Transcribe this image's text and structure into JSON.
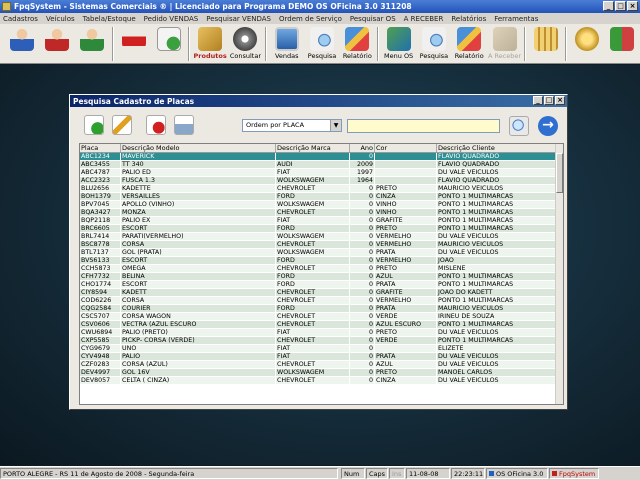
{
  "window_title": "FpqSystem - Sistemas Comerciais ® | Licenciado para Programa DEMO OS OFicina 3.0 311208",
  "menu": [
    "Cadastros",
    "Veículos",
    "Tabela/Estoque",
    "Pedido VENDAS",
    "Pesquisar VENDAS",
    "Ordem de Serviço",
    "Pesquisar OS",
    "A RECEBER",
    "Relatórios",
    "Ferramentas"
  ],
  "toolbar": [
    {
      "icon": "person-blue-icon",
      "label": ""
    },
    {
      "icon": "person-red-icon",
      "label": ""
    },
    {
      "icon": "person-green-icon",
      "label": ""
    },
    {
      "icon": "car-icon",
      "label": ""
    },
    {
      "icon": "calendar-clock-icon",
      "label": ""
    },
    {
      "icon": "boxes-icon",
      "label": "Produtos"
    },
    {
      "icon": "disc-icon",
      "label": "Consultar"
    },
    {
      "icon": "monitor-icon",
      "label": "Vendas"
    },
    {
      "icon": "magnifier-doc-icon",
      "label": "Pesquisa"
    },
    {
      "icon": "report-icon",
      "label": "Relatório"
    },
    {
      "icon": "menu-os-icon",
      "label": "Menu OS"
    },
    {
      "icon": "magnifier-doc-icon",
      "label": "Pesquisa"
    },
    {
      "icon": "report-icon",
      "label": "Relatório"
    },
    {
      "icon": "receivable-icon",
      "label": "A Receber"
    },
    {
      "icon": "calculator-icon",
      "label": ""
    },
    {
      "icon": "coins-icon",
      "label": ""
    },
    {
      "icon": "exit-icon",
      "label": ""
    }
  ],
  "dialog": {
    "title": "Pesquisa Cadastro de Placas",
    "order_select": "Ordem por PLACA",
    "search_value": "",
    "columns": [
      "Placa",
      "Descrição Modelo",
      "Descrição Marca",
      "Ano",
      "Cor",
      "Descrição Cliente"
    ],
    "rows": [
      [
        "ABC1234",
        "MAVERICK",
        "",
        "0",
        "",
        "FLAVIO QUADRADO"
      ],
      [
        "ABC3455",
        "TT 340",
        "AUDI",
        "2009",
        "",
        "FLAVIO QUADRADO"
      ],
      [
        "ABC4787",
        "PALIO ED",
        "FIAT",
        "1997",
        "",
        "DU VALE VEICULOS"
      ],
      [
        "ACC2323",
        "FUSCA 1.3",
        "WOLKSWAGEM",
        "1964",
        "",
        "FLAVIO QUADRADO"
      ],
      [
        "BLU2656",
        "KADETTE",
        "CHEVROLET",
        "0",
        "PRETO",
        "MAURICIO VEICULOS"
      ],
      [
        "BOH1379",
        "VERSAILLES",
        "FORD",
        "0",
        "CINZA",
        "PONTO 1 MULTIMARCAS"
      ],
      [
        "BPV7045",
        "APOLLO (VINHO)",
        "WOLKSWAGEM",
        "0",
        "VINHO",
        "PONTO 1 MULTIMARCAS"
      ],
      [
        "BQA3427",
        "MONZA",
        "CHEVROLET",
        "0",
        "VINHO",
        "PONTO 1 MULTIMARCAS"
      ],
      [
        "BQP2118",
        "PALIO EX",
        "FIAT",
        "0",
        "GRAFITE",
        "PONTO 1 MULTIMARCAS"
      ],
      [
        "BRC6605",
        "ESCORT",
        "FORD",
        "0",
        "PRETO",
        "PONTO 1 MULTIMARCAS"
      ],
      [
        "BRL7414",
        "PARATI(VERMELHO)",
        "WOLKSWAGEM",
        "0",
        "VERMELHO",
        "DU VALE VEICULOS"
      ],
      [
        "BSC8778",
        "CORSA",
        "CHEVROLET",
        "0",
        "VERMELHO",
        "MAURICIO VEICULOS"
      ],
      [
        "BTL7137",
        "GOL (PRATA)",
        "WOLKSWAGEM",
        "0",
        "PRATA",
        "DU VALE VEICULOS"
      ],
      [
        "BVS6133",
        "ESCORT",
        "FORD",
        "0",
        "VERMELHO",
        "JOÃO"
      ],
      [
        "CCH5873",
        "OMEGA",
        "CHEVROLET",
        "0",
        "PRETO",
        "MISLENE"
      ],
      [
        "CFH7732",
        "BELINA",
        "FORD",
        "0",
        "AZUL",
        "PONTO 1 MULTIMARCAS"
      ],
      [
        "CHO1774",
        "ESCORT",
        "FORD",
        "0",
        "PRATA",
        "PONTO 1 MULTIMARCAS"
      ],
      [
        "CIY8594",
        "KADETT",
        "CHEVROLET",
        "0",
        "GRAFITE",
        "JOÃO DO KADETT"
      ],
      [
        "COD6226",
        "CORSA",
        "CHEVROLET",
        "0",
        "VERMELHO",
        "PONTO 1 MULTIMARCAS"
      ],
      [
        "CQG2584",
        "COURIER",
        "FORD",
        "0",
        "PRATA",
        "MAURICIO VEICULOS"
      ],
      [
        "CSC5707",
        "CORSA WAGON",
        "CHEVROLET",
        "0",
        "VERDE",
        "IRINEU DE SOUZA"
      ],
      [
        "CSV0606",
        "VECTRA (AZUL ESCURO",
        "CHEVROLET",
        "0",
        "AZUL ESCURO",
        "PONTO 1 MULTIMARCAS"
      ],
      [
        "CWU6894",
        "PALIO (PRETO)",
        "FIAT",
        "0",
        "PRETO",
        "DU VALE VEICULOS"
      ],
      [
        "CXP5585",
        "PICKP- CORSA (VERDE)",
        "CHEVROLET",
        "0",
        "VERDE",
        "PONTO 1 MULTIMARCAS"
      ],
      [
        "CYG9679",
        "UNO",
        "FIAT",
        "0",
        "",
        "ELIZETE"
      ],
      [
        "CYV4948",
        "PALIO",
        "FIAT",
        "0",
        "PRATA",
        "DU VALE VEICULOS"
      ],
      [
        "CZF0283",
        "CORSA (AZUL)",
        "CHEVROLET",
        "0",
        "AZUL",
        "DU VALE VEICULOS"
      ],
      [
        "DEV4997",
        "GOL 16V",
        "WOLKSWAGEM",
        "0",
        "PRETO",
        "MANOEL CARLOS"
      ],
      [
        "DEV8057",
        "CELTA ( CINZA)",
        "CHEVROLET",
        "0",
        "CINZA",
        "DU VALE VEICULOS"
      ]
    ]
  },
  "status": {
    "location_date": "PORTO ALEGRE - RS 11 de Agosto de 2008 - Segunda-feira",
    "num": "Num",
    "caps": "Caps",
    "ins": "Ins",
    "date": "11-08-08",
    "time": "22:23:11",
    "product": "OS OFicina 3.0",
    "brand": "FpqSystem"
  },
  "colors": {
    "selected_row": "#2b8f93",
    "row_even": "#d9e6d9",
    "row_odd": "#eef5ee",
    "desktop": "#17303f"
  }
}
